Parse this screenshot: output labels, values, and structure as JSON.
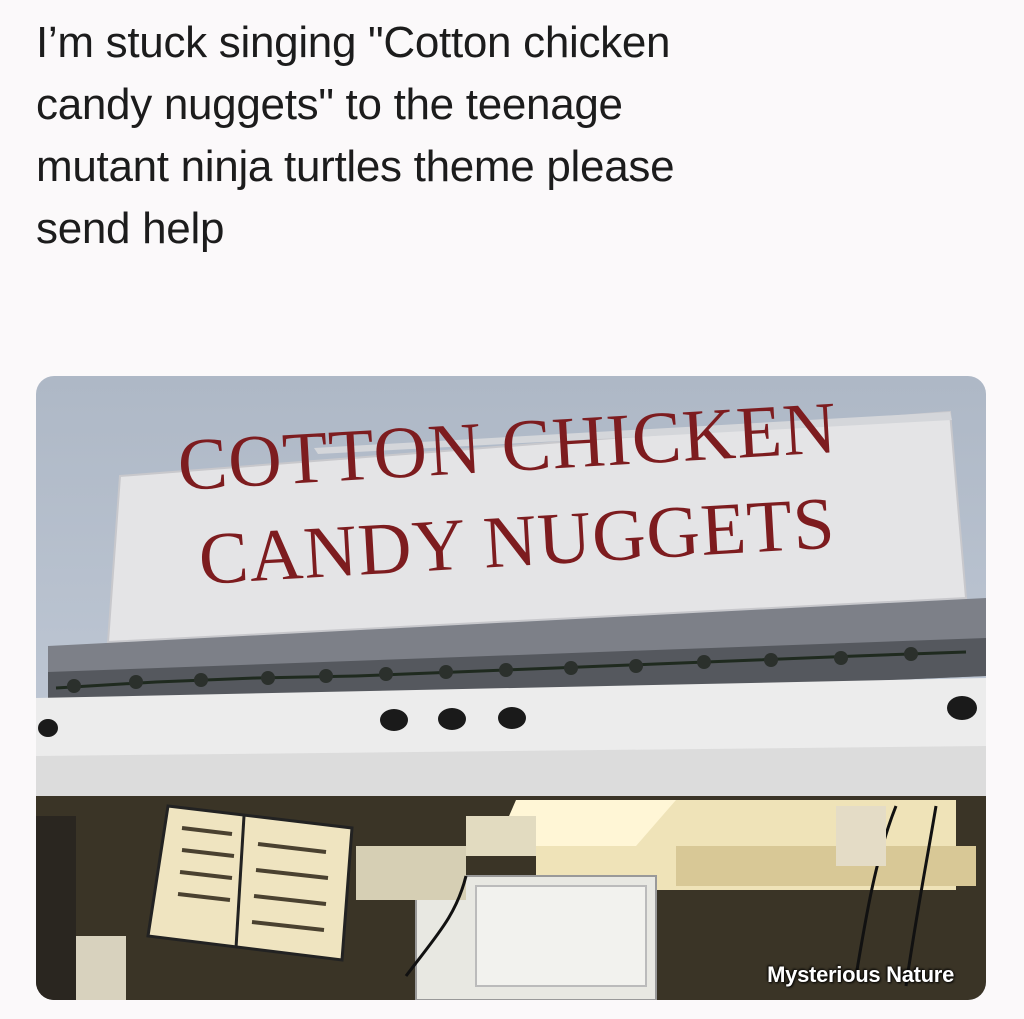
{
  "caption": {
    "line1": "I’m stuck singing \"Cotton chicken",
    "line2": "candy nuggets\" to the teenage",
    "line3": "mutant ninja turtles theme please",
    "line4": "send help"
  },
  "photo": {
    "sign_line1": "COTTON CHICKEN",
    "sign_line2": "CANDY NUGGETS",
    "watermark": "Mysterious Nature",
    "colors": {
      "sky": "#b6bfcc",
      "sign_board": "#e3e3e3",
      "sign_text": "#7d1c1f",
      "truck_body": "#eeeeee",
      "interior_light": "#efe2b6"
    }
  }
}
